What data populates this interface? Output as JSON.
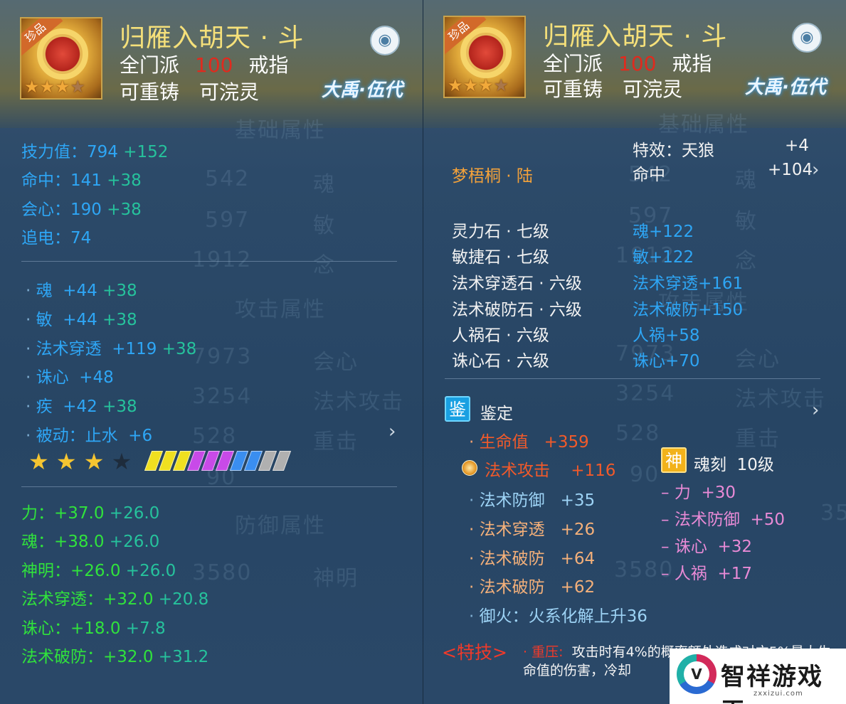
{
  "item": {
    "name": "归雁入胡天 · 斗",
    "sect": "全门派",
    "level": "100",
    "type": "戒指",
    "reforge": "可重铸",
    "infuse": "可浣灵",
    "brand": "大禹·伍代",
    "rarity_tag": "珍品",
    "colors": {
      "name": "#f5e07a",
      "level": "#e02a1e"
    }
  },
  "left": {
    "ghost_texts": [
      "基础属性",
      "542",
      "魂",
      "597",
      "敏",
      "1912",
      "念",
      "攻击属性",
      "7973",
      "会心",
      "3254",
      "法术攻击",
      "528",
      "重击",
      "90",
      "防御属性",
      "3580",
      "神明"
    ],
    "base_stats": [
      {
        "label": "技力值：794",
        "bonus": "+152"
      },
      {
        "label": "命中：141",
        "bonus": "+38"
      },
      {
        "label": "会心：190",
        "bonus": "+38"
      },
      {
        "label": "追电：74",
        "bonus": ""
      }
    ],
    "attrs": [
      {
        "name": "魂",
        "value": "+44",
        "bonus": "+38"
      },
      {
        "name": "敏",
        "value": "+44",
        "bonus": "+38"
      },
      {
        "name": "法术穿透",
        "value": "+119",
        "bonus": "+38"
      },
      {
        "name": "诛心",
        "value": "+48",
        "bonus": ""
      },
      {
        "name": "疾",
        "value": "+42",
        "bonus": "+38"
      },
      {
        "name": "被动：止水",
        "value": "+6",
        "bonus": ""
      }
    ],
    "rating_stars": 3,
    "rating_stars_total": 4,
    "gem_colors": [
      "#f0e020",
      "#f0e020",
      "#f0e020",
      "#c84ae8",
      "#c84ae8",
      "#c84ae8",
      "#3a8ef0",
      "#3a8ef0",
      "#b0b0b0",
      "#b0b0b0"
    ],
    "green_stats": [
      {
        "label": "力：+37.0",
        "bonus": "+26.0"
      },
      {
        "label": "魂：+38.0",
        "bonus": "+26.0"
      },
      {
        "label": "神明：+26.0",
        "bonus": "+26.0"
      },
      {
        "label": "法术穿透：+32.0",
        "bonus": "+20.8"
      },
      {
        "label": "诛心：+18.0",
        "bonus": "+7.8"
      },
      {
        "label": "法术破防：+32.0",
        "bonus": "+31.2"
      }
    ]
  },
  "right": {
    "ghost_texts": [
      "基础属性",
      "542",
      "魂",
      "597",
      "敏",
      "1912",
      "念",
      "攻击属性",
      "7973",
      "会心",
      "3254",
      "法术攻击",
      "528",
      "重击",
      "90",
      "3580",
      "35"
    ],
    "set_name": "梦梧桐 · 陆",
    "set_effects": [
      {
        "label": "特效：天狼",
        "value": "+4"
      },
      {
        "label": "命中",
        "value": "+104"
      }
    ],
    "stones": [
      {
        "name": "灵力石 · 七级",
        "effect": "魂+122"
      },
      {
        "name": "敏捷石 · 七级",
        "effect": "敏+122"
      },
      {
        "name": "法术穿透石 · 六级",
        "effect": "法术穿透+161"
      },
      {
        "name": "法术破防石 · 六级",
        "effect": "法术破防+150"
      },
      {
        "name": "人祸石 · 六级",
        "effect": "人祸+58"
      },
      {
        "name": "诛心石 · 六级",
        "effect": "诛心+70"
      }
    ],
    "identify": {
      "badge": "鉴",
      "title": "鉴定",
      "lines": [
        {
          "name": "生命值",
          "value": "+359"
        },
        {
          "name": "法术攻击",
          "value": "+116"
        },
        {
          "name": "法术防御",
          "value": "+35"
        },
        {
          "name": "法术穿透",
          "value": "+26"
        },
        {
          "name": "法术破防",
          "value": "+64"
        },
        {
          "name": "法术破防",
          "value": "+62"
        },
        {
          "name": "御火：火系化解上升36",
          "value": ""
        }
      ]
    },
    "soul": {
      "badge": "神",
      "title": "魂刻",
      "level": "10级",
      "lines": [
        {
          "name": "力",
          "value": "+30"
        },
        {
          "name": "法术防御",
          "value": "+50"
        },
        {
          "name": "诛心",
          "value": "+32"
        },
        {
          "name": "人祸",
          "value": "+17"
        }
      ]
    },
    "skill": {
      "label": "<特技>",
      "name": "· 重压:",
      "text": "攻击时有4%的概率额外造成对方5%最大生命值的伤害，冷却"
    }
  },
  "watermark": {
    "title": "智祥游戏王",
    "url": "zxxizui.com"
  }
}
